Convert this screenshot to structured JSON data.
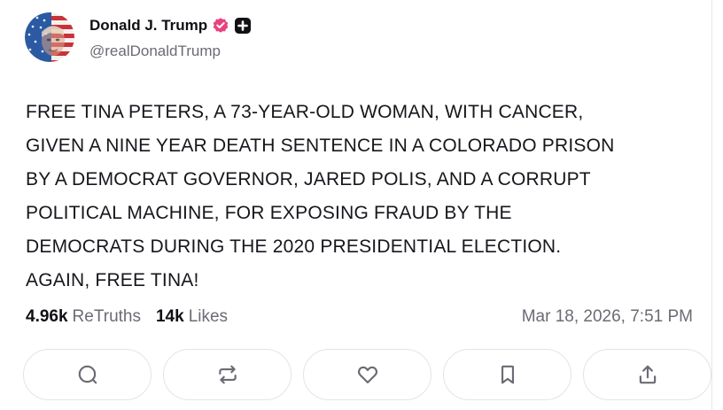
{
  "author": {
    "display_name": "Donald J. Trump",
    "handle": "@realDonaldTrump",
    "verified_badge_icon": "verified-check-icon",
    "extra_badge_icon": "truth-plus-icon",
    "verified_color": "#e8437f"
  },
  "post": {
    "text": "FREE TINA PETERS, A 73-YEAR-OLD WOMAN, WITH CANCER,\nGIVEN A NINE YEAR DEATH SENTENCE IN A COLORADO PRISON\nBY A DEMOCRAT GOVERNOR, JARED POLIS, AND A CORRUPT\nPOLITICAL MACHINE, FOR EXPOSING FRAUD BY THE\nDEMOCRATS DURING THE 2020 PRESIDENTIAL ELECTION.\nAGAIN, FREE TINA!",
    "timestamp": "Mar 18, 2026, 7:51 PM"
  },
  "stats": {
    "retruths_count": "4.96k",
    "retruths_label": "ReTruths",
    "likes_count": "14k",
    "likes_label": "Likes"
  },
  "actions": [
    {
      "name": "reply",
      "icon": "comment-icon"
    },
    {
      "name": "retruth",
      "icon": "repost-icon"
    },
    {
      "name": "like",
      "icon": "heart-icon"
    },
    {
      "name": "bookmark",
      "icon": "bookmark-icon"
    },
    {
      "name": "share",
      "icon": "share-icon"
    }
  ],
  "colors": {
    "icon": "#6b6b74",
    "muted_text": "#6b6b74",
    "border": "#e4e4e8"
  }
}
